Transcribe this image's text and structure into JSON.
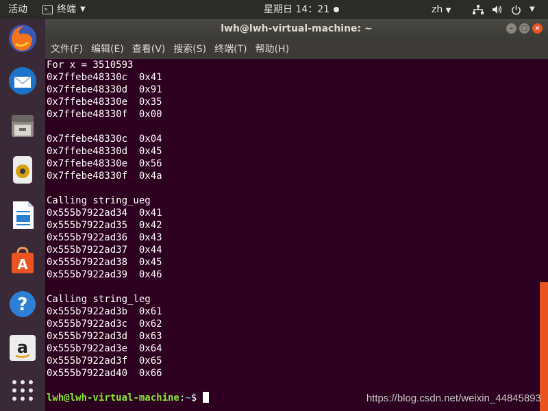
{
  "topbar": {
    "activities": "活动",
    "app_name": "终端",
    "clock": "星期日 14：21",
    "lang": "zh"
  },
  "dock": {
    "items": [
      {
        "name": "firefox-icon"
      },
      {
        "name": "thunderbird-icon"
      },
      {
        "name": "files-icon"
      },
      {
        "name": "rhythmbox-icon"
      },
      {
        "name": "libreoffice-writer-icon"
      },
      {
        "name": "software-center-icon"
      },
      {
        "name": "help-icon"
      },
      {
        "name": "amazon-icon"
      },
      {
        "name": "show-apps-icon"
      }
    ]
  },
  "window": {
    "title": "lwh@lwh-virtual-machine: ~",
    "menu": [
      "文件(F)",
      "编辑(E)",
      "查看(V)",
      "搜索(S)",
      "终端(T)",
      "帮助(H)"
    ]
  },
  "terminal": {
    "lines": [
      "For x = 3510593",
      "0x7ffebe48330c  0x41",
      "0x7ffebe48330d  0x91",
      "0x7ffebe48330e  0x35",
      "0x7ffebe48330f  0x00",
      "",
      "0x7ffebe48330c  0x04",
      "0x7ffebe48330d  0x45",
      "0x7ffebe48330e  0x56",
      "0x7ffebe48330f  0x4a",
      "",
      "Calling string_ueg",
      "0x555b7922ad34  0x41",
      "0x555b7922ad35  0x42",
      "0x555b7922ad36  0x43",
      "0x555b7922ad37  0x44",
      "0x555b7922ad38  0x45",
      "0x555b7922ad39  0x46",
      "",
      "Calling string_leg",
      "0x555b7922ad3b  0x61",
      "0x555b7922ad3c  0x62",
      "0x555b7922ad3d  0x63",
      "0x555b7922ad3e  0x64",
      "0x555b7922ad3f  0x65",
      "0x555b7922ad40  0x66",
      ""
    ],
    "prompt_user": "lwh@lwh-virtual-machine",
    "prompt_sep": ":",
    "prompt_path": "~",
    "prompt_symbol": "$ "
  },
  "watermark": "https://blog.csdn.net/weixin_44845893",
  "colors": {
    "terminal_bg": "#2c001e",
    "accent": "#e95420",
    "prompt_user": "#8ae234",
    "prompt_path": "#729fcf"
  }
}
